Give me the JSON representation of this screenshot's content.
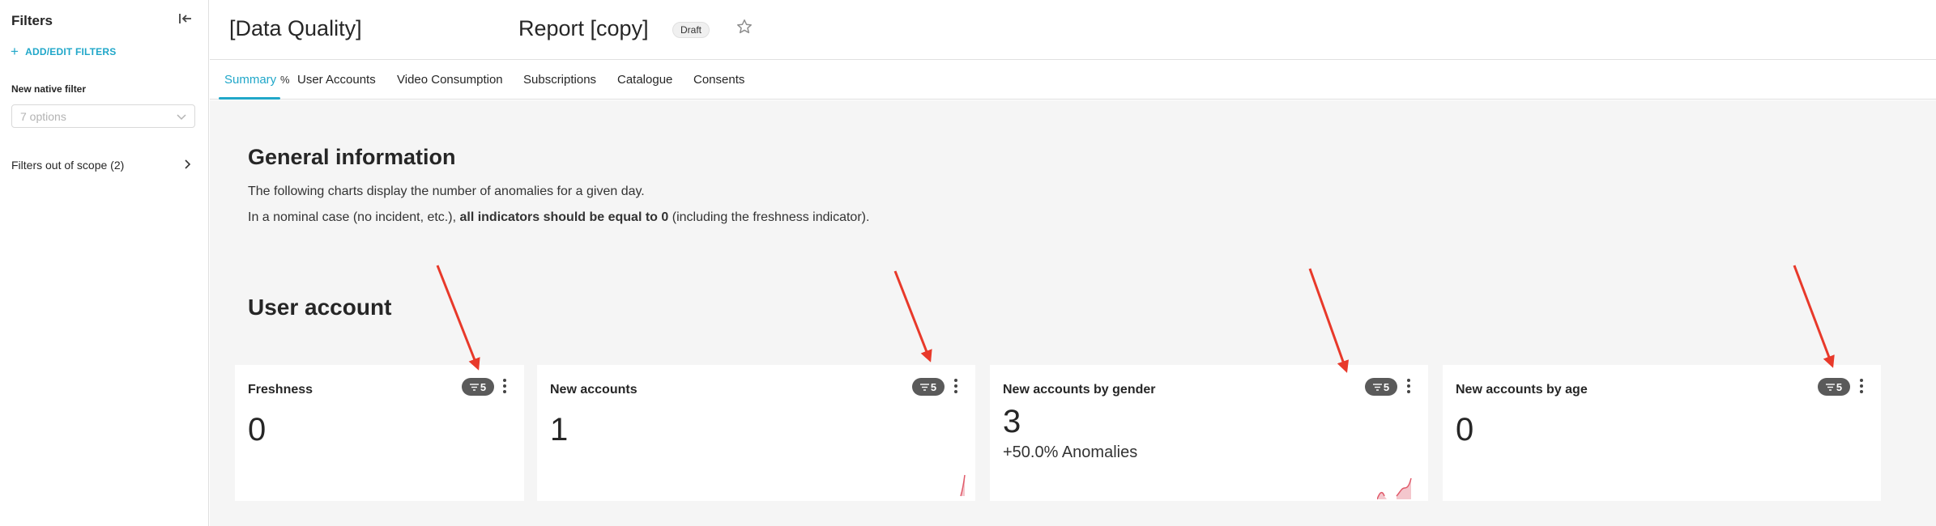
{
  "sidebar": {
    "title": "Filters",
    "add_filters": "ADD/EDIT FILTERS",
    "native_filter_label": "New native filter",
    "select_placeholder": "7 options",
    "out_of_scope": "Filters out of scope (2)"
  },
  "header": {
    "title": "[Data Quality]",
    "title_part2": "Report [copy]",
    "status": "Draft"
  },
  "tabs": [
    {
      "label": "Summary"
    },
    {
      "label": "User Accounts"
    },
    {
      "label": "Video Consumption"
    },
    {
      "label": "Subscriptions"
    },
    {
      "label": "Catalogue"
    },
    {
      "label": "Consents"
    }
  ],
  "main": {
    "general_heading": "General information",
    "general_line1": "The following charts display the number of anomalies for a given day.",
    "general_line2_before": "In a nominal case (no incident, etc.), ",
    "general_line2_bold": "all indicators should be equal to 0",
    "general_line2_after": " (including the freshness indicator).",
    "user_heading": "User account"
  },
  "cards": [
    {
      "title": "Freshness",
      "filter_count": "5",
      "value": "0"
    },
    {
      "title": "New accounts",
      "filter_count": "5",
      "value": "1"
    },
    {
      "title": "New accounts by gender",
      "filter_count": "5",
      "value": "3",
      "change": "+50.0% Anomalies"
    },
    {
      "title": "New accounts by age",
      "filter_count": "5",
      "value": "0"
    }
  ],
  "colors": {
    "accent": "#20a7c9",
    "annotation_arrow": "#e8392a",
    "sparkline": "#e05a6a"
  }
}
